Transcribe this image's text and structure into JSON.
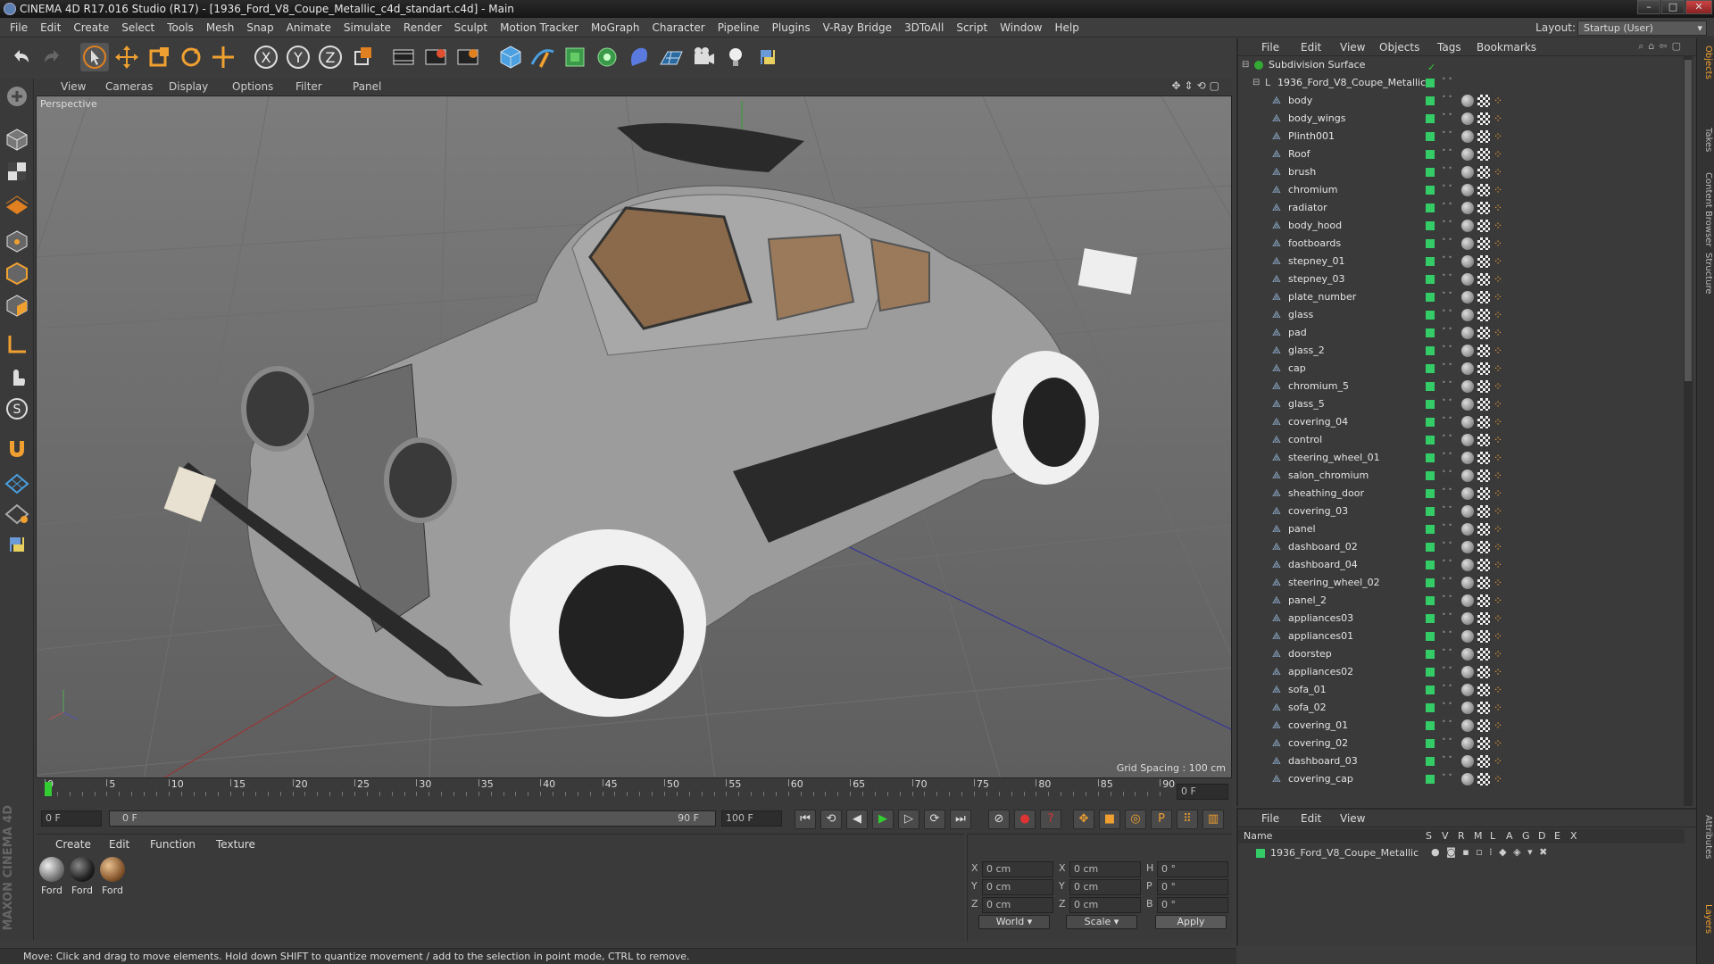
{
  "window": {
    "title": "CINEMA 4D R17.016 Studio (R17) - [1936_Ford_V8_Coupe_Metallic_c4d_standart.c4d] - Main"
  },
  "menubar": {
    "items": [
      "File",
      "Edit",
      "Create",
      "Select",
      "Tools",
      "Mesh",
      "Snap",
      "Animate",
      "Simulate",
      "Render",
      "Sculpt",
      "Motion Tracker",
      "MoGraph",
      "Character",
      "Pipeline",
      "Plugins",
      "V-Ray Bridge",
      "3DToAll",
      "Script",
      "Window",
      "Help"
    ]
  },
  "layout": {
    "label": "Layout:",
    "value": "Startup (User)"
  },
  "viewport": {
    "menu": [
      "View",
      "Cameras",
      "Display",
      "Options",
      "Filter",
      "Panel"
    ],
    "camera_label": "Perspective",
    "grid_spacing": "Grid Spacing : 100 cm"
  },
  "timeline": {
    "ticks": [
      "0",
      "5",
      "10",
      "15",
      "20",
      "25",
      "30",
      "35",
      "40",
      "45",
      "50",
      "55",
      "60",
      "65",
      "70",
      "75",
      "80",
      "85",
      "90"
    ],
    "current_frame": "0 F"
  },
  "transport": {
    "start": "0 F",
    "range_start": "0 F",
    "range_end": "90 F",
    "end": "100 F"
  },
  "material_panel": {
    "menu": [
      "Create",
      "Edit",
      "Function",
      "Texture"
    ],
    "materials": [
      "Ford",
      "Ford",
      "Ford"
    ]
  },
  "coordinates": {
    "rows": [
      {
        "a": "X",
        "av": "0 cm",
        "b": "X",
        "bv": "0 cm",
        "c": "H",
        "cv": "0 °"
      },
      {
        "a": "Y",
        "av": "0 cm",
        "b": "Y",
        "bv": "0 cm",
        "c": "P",
        "cv": "0 °"
      },
      {
        "a": "Z",
        "av": "0 cm",
        "b": "Z",
        "bv": "0 cm",
        "c": "B",
        "cv": "0 °"
      }
    ],
    "mode": "World",
    "transform": "Scale",
    "apply": "Apply"
  },
  "objects_panel": {
    "menu": [
      "File",
      "Edit",
      "View",
      "Objects",
      "Tags",
      "Bookmarks"
    ],
    "root": "Subdivision Surface",
    "group": "1936_Ford_V8_Coupe_Metallic",
    "items": [
      "body",
      "body_wings",
      "Plinth001",
      "Roof",
      "brush",
      "chromium",
      "radiator",
      "body_hood",
      "footboards",
      "stepney_01",
      "stepney_03",
      "plate_number",
      "glass",
      "pad",
      "glass_2",
      "cap",
      "chromium_5",
      "glass_5",
      "covering_04",
      "control",
      "steering_wheel_01",
      "salon_chromium",
      "sheathing_door",
      "covering_03",
      "panel",
      "dashboard_02",
      "dashboard_04",
      "steering_wheel_02",
      "panel_2",
      "appliances03",
      "appliances01",
      "doorstep",
      "appliances02",
      "sofa_01",
      "sofa_02",
      "covering_01",
      "covering_02",
      "dashboard_03",
      "covering_cap"
    ]
  },
  "layers_panel": {
    "menu": [
      "File",
      "Edit",
      "View"
    ],
    "header_name": "Name",
    "header_cols": [
      "S",
      "V",
      "R",
      "M",
      "L",
      "A",
      "G",
      "D",
      "E",
      "X"
    ],
    "layer": "1936_Ford_V8_Coupe_Metallic"
  },
  "side_tabs": [
    "Objects",
    "Takes",
    "Content Browser",
    "Structure",
    "Attributes",
    "Layers"
  ],
  "status": {
    "text": "Move: Click and drag to move elements. Hold down SHIFT to quantize movement / add to the selection in point mode, CTRL to remove."
  },
  "brand": {
    "text": "MAXON CINEMA 4D"
  },
  "colors": {
    "accent": "#f0a030",
    "layer_green": "#33cc66",
    "select_blue": "#4a78c8"
  }
}
